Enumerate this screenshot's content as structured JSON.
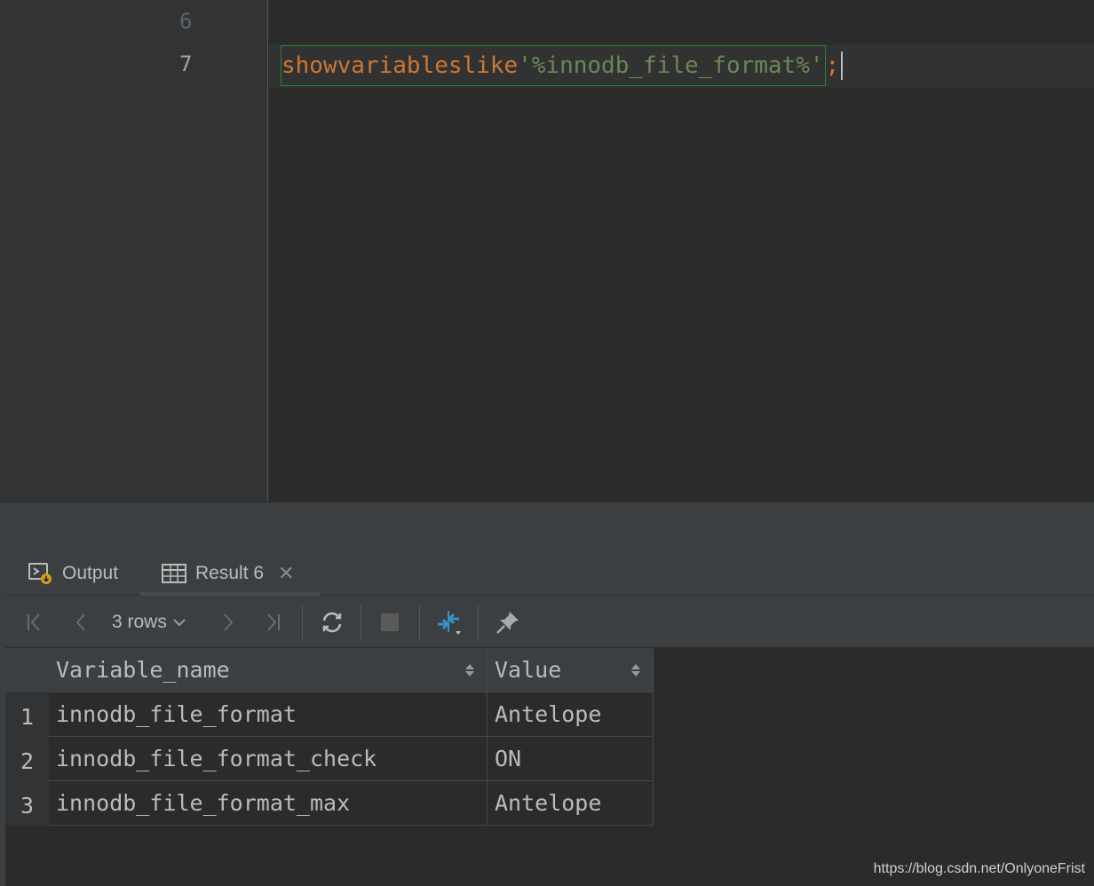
{
  "editor": {
    "line_numbers": [
      "6",
      "7"
    ],
    "code": {
      "kw1": "show",
      "kw2": "variables",
      "kw3": "like",
      "string": "'%innodb_file_format%'",
      "terminator": ";"
    }
  },
  "results": {
    "tabs": [
      {
        "label": "Output",
        "icon": "console-output-icon"
      },
      {
        "label": "Result 6",
        "icon": "table-grid-icon",
        "active": true
      }
    ],
    "close_glyph": "✕",
    "toolbar": {
      "rows_label": "3 rows",
      "icons": [
        "first-page-icon",
        "prev-page-icon",
        "next-page-icon",
        "last-page-icon",
        "refresh-icon",
        "stop-icon",
        "compare-icon",
        "pin-icon"
      ]
    },
    "columns": [
      "Variable_name",
      "Value"
    ],
    "rows": [
      {
        "num": "1",
        "variable_name": "innodb_file_format",
        "value": "Antelope"
      },
      {
        "num": "2",
        "variable_name": "innodb_file_format_check",
        "value": "ON"
      },
      {
        "num": "3",
        "variable_name": "innodb_file_format_max",
        "value": "Antelope"
      }
    ]
  },
  "watermark": "https://blog.csdn.net/OnlyoneFrist",
  "colors": {
    "editor_bg": "#2b2b2b",
    "keyword": "#cc7832",
    "string": "#6a8759",
    "statement_highlight": "#1f8a2e",
    "panel_bg": "#3c3f41"
  }
}
